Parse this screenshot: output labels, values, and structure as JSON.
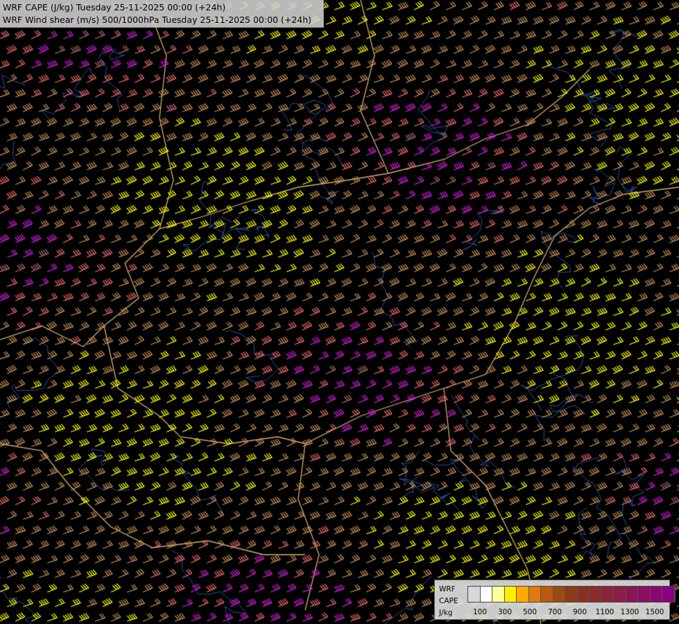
{
  "header": {
    "title_line1": "WRF CAPE (J/kg) Tuesday 25-11-2025 00:00 (+24h)",
    "title_line2": "WRF Wind shear (m/s) 500/1000hPa Tuesday 25-11-2025 00:00 (+24h)"
  },
  "legend": {
    "label_line1": "WRF",
    "label_line2": "CAPE",
    "label_line3": "J/kg",
    "swatch_colors": [
      "#d8d8d8",
      "#ffffff",
      "#ffff99",
      "#ffee00",
      "#ffaa00",
      "#e07a10",
      "#b85a10",
      "#9b4a12",
      "#8c3a18",
      "#8a3020",
      "#8a2a2c",
      "#8a2436",
      "#8a1e44",
      "#8a1654",
      "#8a0e62",
      "#8a0870",
      "#8a007c"
    ],
    "tick_labels": [
      "100",
      "300",
      "500",
      "700",
      "900",
      "1100",
      "1300",
      "1500"
    ]
  },
  "colors": {
    "background": "#000000",
    "barb_yellow": "#ffff00",
    "barb_tan": "#c8965a",
    "barb_salmon": "#f07070",
    "barb_magenta": "#e020e0",
    "barb_rose": "#b07070",
    "border_tan": "#d8b070",
    "river_blue": "#3050a0"
  }
}
